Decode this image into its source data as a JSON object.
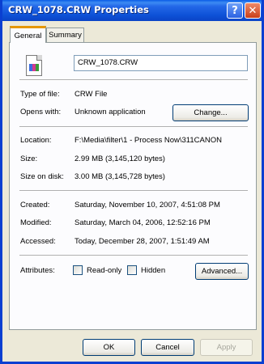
{
  "window": {
    "title": "CRW_1078.CRW Properties",
    "help_glyph": "?",
    "close_glyph": "✕"
  },
  "tabs": {
    "general": "General",
    "summary": "Summary"
  },
  "file": {
    "icon": "crw-file-icon",
    "name": "CRW_1078.CRW"
  },
  "type": {
    "label": "Type of file:",
    "value": "CRW File"
  },
  "opens": {
    "label": "Opens with:",
    "value": "Unknown application",
    "change_button": "Change..."
  },
  "location": {
    "label": "Location:",
    "value": "F:\\Media\\filter\\1 - Process Now\\311CANON"
  },
  "size": {
    "label": "Size:",
    "value": "2.99 MB (3,145,120 bytes)"
  },
  "size_on_disk": {
    "label": "Size on disk:",
    "value": "3.00 MB (3,145,728 bytes)"
  },
  "created": {
    "label": "Created:",
    "value": "Saturday, November 10, 2007, 4:51:08 PM"
  },
  "modified": {
    "label": "Modified:",
    "value": "Saturday, March 04, 2006, 12:52:16 PM"
  },
  "accessed": {
    "label": "Accessed:",
    "value": "Today, December 28, 2007, 1:51:49 AM"
  },
  "attributes": {
    "label": "Attributes:",
    "read_only": {
      "label": "Read-only",
      "checked": false
    },
    "hidden": {
      "label": "Hidden",
      "checked": false
    },
    "advanced_button": "Advanced..."
  },
  "footer": {
    "ok": "OK",
    "cancel": "Cancel",
    "apply": "Apply"
  }
}
